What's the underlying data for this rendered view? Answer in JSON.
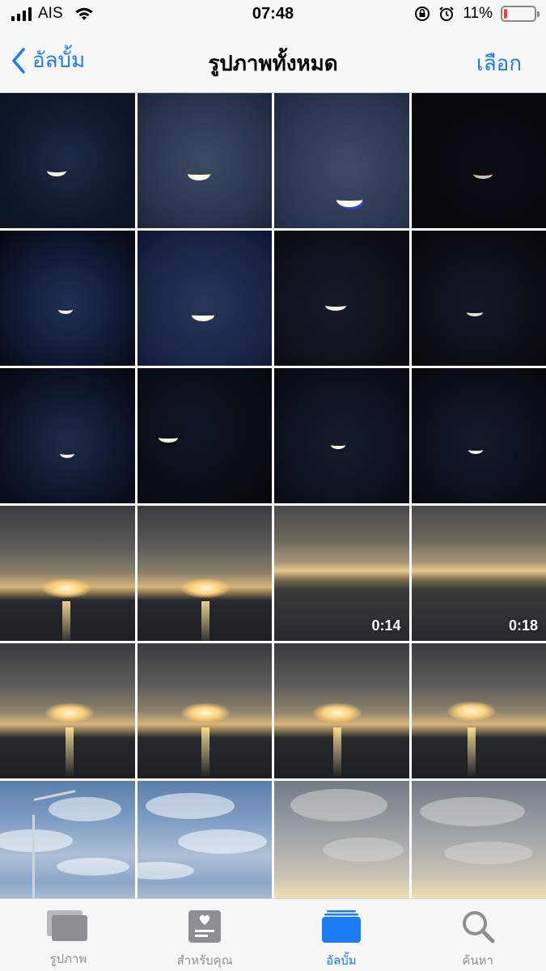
{
  "status_bar": {
    "carrier": "AIS",
    "time": "07:48",
    "battery_percent_label": "11%",
    "battery_level": 0.11,
    "battery_color": "#ff3b30",
    "icons": [
      "signal-icon",
      "wifi-icon",
      "orientation-lock-icon",
      "alarm-icon",
      "battery-icon"
    ]
  },
  "nav": {
    "back_label": "อัลบั้ม",
    "title": "รูปภาพทั้งหมด",
    "select_label": "เลือก",
    "accent_color": "#1b7cf5"
  },
  "grid": {
    "columns": 4,
    "items": [
      {
        "kind": "photo",
        "subject": "moon",
        "duration": ""
      },
      {
        "kind": "photo",
        "subject": "moon",
        "duration": ""
      },
      {
        "kind": "photo",
        "subject": "moon",
        "duration": ""
      },
      {
        "kind": "photo",
        "subject": "moon",
        "duration": ""
      },
      {
        "kind": "photo",
        "subject": "moon",
        "duration": ""
      },
      {
        "kind": "photo",
        "subject": "moon",
        "duration": ""
      },
      {
        "kind": "photo",
        "subject": "moon",
        "duration": ""
      },
      {
        "kind": "photo",
        "subject": "moon",
        "duration": ""
      },
      {
        "kind": "photo",
        "subject": "moon",
        "duration": ""
      },
      {
        "kind": "photo",
        "subject": "moon",
        "duration": ""
      },
      {
        "kind": "photo",
        "subject": "moon",
        "duration": ""
      },
      {
        "kind": "photo",
        "subject": "moon",
        "duration": ""
      },
      {
        "kind": "photo",
        "subject": "sunset",
        "duration": ""
      },
      {
        "kind": "photo",
        "subject": "sunset",
        "duration": ""
      },
      {
        "kind": "video",
        "subject": "sunset",
        "duration": "0:14"
      },
      {
        "kind": "video",
        "subject": "sunset",
        "duration": "0:18"
      },
      {
        "kind": "photo",
        "subject": "sunset",
        "duration": ""
      },
      {
        "kind": "photo",
        "subject": "sunset",
        "duration": ""
      },
      {
        "kind": "photo",
        "subject": "sunset",
        "duration": ""
      },
      {
        "kind": "photo",
        "subject": "sunset",
        "duration": ""
      },
      {
        "kind": "photo",
        "subject": "sky",
        "duration": ""
      },
      {
        "kind": "photo",
        "subject": "sky",
        "duration": ""
      },
      {
        "kind": "photo",
        "subject": "sky",
        "duration": ""
      },
      {
        "kind": "photo",
        "subject": "sky",
        "duration": ""
      }
    ]
  },
  "tab_bar": {
    "tabs": [
      {
        "label": "รูปภาพ",
        "icon": "photos-icon",
        "active": false
      },
      {
        "label": "สำหรับคุณ",
        "icon": "for-you-icon",
        "active": false
      },
      {
        "label": "อัลบั้ม",
        "icon": "albums-icon",
        "active": true
      },
      {
        "label": "ค้นหา",
        "icon": "search-icon",
        "active": false
      }
    ]
  }
}
